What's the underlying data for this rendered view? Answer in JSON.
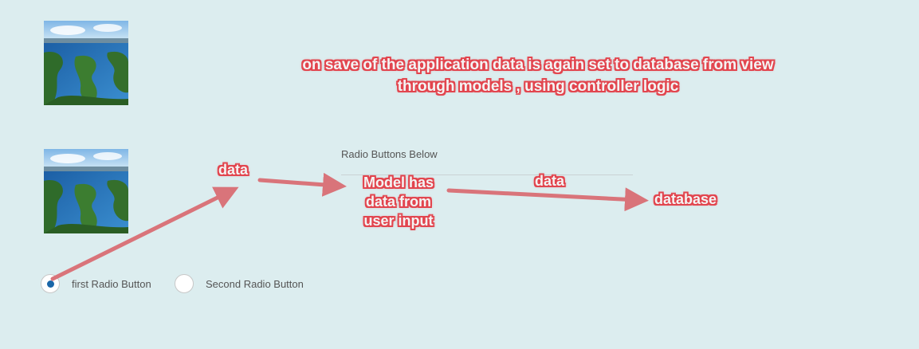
{
  "section": {
    "title": "Radio Buttons Below"
  },
  "radios": [
    {
      "label": "first Radio Button",
      "checked": true
    },
    {
      "label": "Second Radio Button",
      "checked": false
    }
  ],
  "annotations": {
    "top_line1": "on save of the application data is again set to database from view",
    "top_line2": "through models , using controller logic",
    "data_left": "data",
    "model_line1": "Model has",
    "model_line2": "data from",
    "model_line3": "user input",
    "data_right": "data",
    "database": "database"
  },
  "colors": {
    "background": "#dcedef",
    "annotation_outline": "#e2454e",
    "arrow": "#d9747a",
    "radio_selected": "#1a66a8"
  },
  "images": [
    {
      "icon": "lake-landscape-image"
    },
    {
      "icon": "lake-landscape-image"
    }
  ]
}
